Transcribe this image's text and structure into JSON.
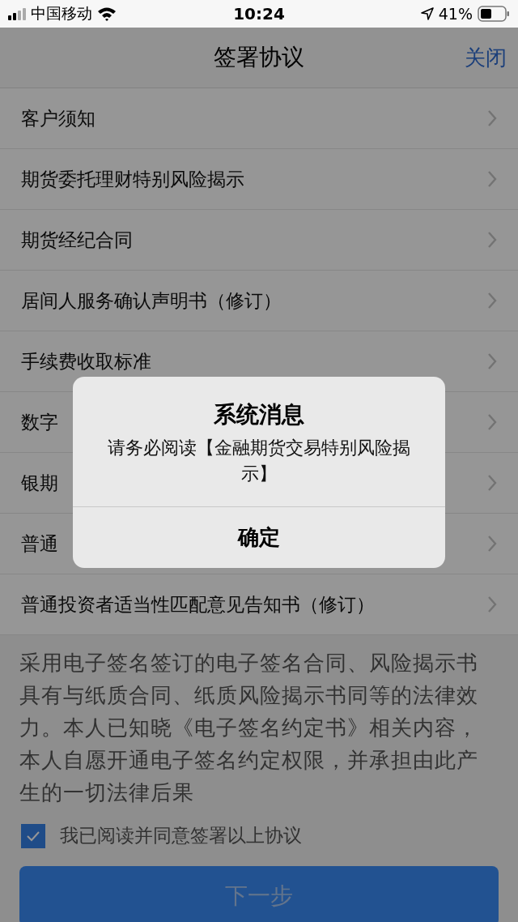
{
  "status_bar": {
    "carrier": "中国移动",
    "time": "10:24",
    "battery": "41%"
  },
  "nav": {
    "title": "签署协议",
    "close": "关闭"
  },
  "items": [
    {
      "label": "客户须知"
    },
    {
      "label": "期货委托理财特别风险揭示"
    },
    {
      "label": "期货经纪合同"
    },
    {
      "label": "居间人服务确认声明书（修订）"
    },
    {
      "label": "手续费收取标准"
    },
    {
      "label": "数字"
    },
    {
      "label": "银期"
    },
    {
      "label": "普通"
    },
    {
      "label": "普通投资者适当性匹配意见告知书（修订）"
    }
  ],
  "notice": "采用电子签名签订的电子签名合同、风险揭示书具有与纸质合同、纸质风险揭示书同等的法律效力。本人已知晓《电子签名约定书》相关内容，本人自愿开通电子签名约定权限，并承担由此产生的一切法律后果",
  "agree": {
    "label": "我已阅读并同意签署以上协议",
    "checked": true
  },
  "next_button": "下一步",
  "dialog": {
    "title": "系统消息",
    "message": "请务必阅读【金融期货交易特别风险揭示】",
    "button": "确定"
  }
}
